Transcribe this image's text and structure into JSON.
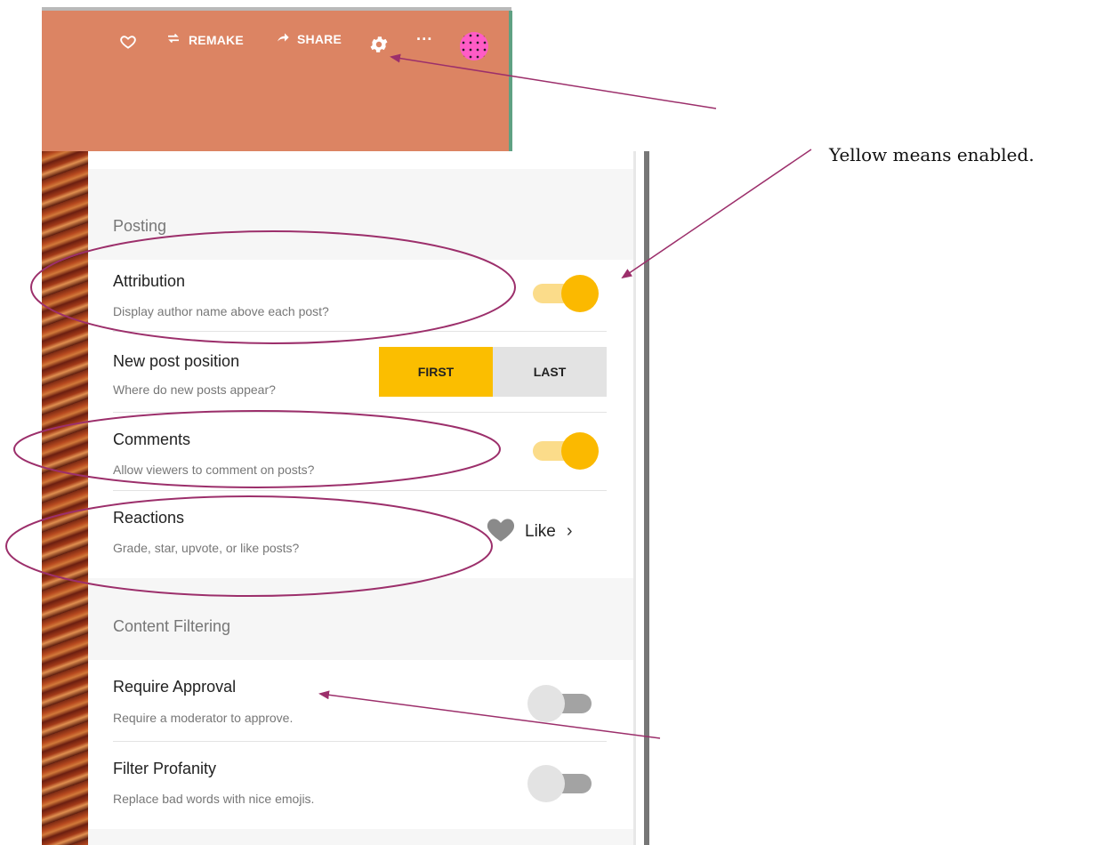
{
  "toolbar": {
    "remake_label": "REMAKE",
    "share_label": "SHARE",
    "more_label": "···",
    "icons": [
      "heart-icon",
      "remake-icon",
      "share-icon",
      "gear-icon",
      "more-icon",
      "avatar"
    ],
    "background_color": "#dc8463"
  },
  "settings": {
    "posting_section": "Posting",
    "attribution": {
      "title": "Attribution",
      "description": "Display author name above each post?",
      "enabled": true
    },
    "new_post_position": {
      "title": "New post position",
      "description": "Where do new posts appear?",
      "options": [
        "FIRST",
        "LAST"
      ],
      "selected": "FIRST"
    },
    "comments": {
      "title": "Comments",
      "description": "Allow viewers to comment on posts?",
      "enabled": true
    },
    "reactions": {
      "title": "Reactions",
      "description": "Grade, star, upvote, or like posts?",
      "value": "Like"
    },
    "content_filtering_section": "Content Filtering",
    "require_approval": {
      "title": "Require Approval",
      "description": "Require a moderator to approve.",
      "enabled": false
    },
    "filter_profanity": {
      "title": "Filter Profanity",
      "description": "Replace bad words with nice emojis.",
      "enabled": false
    }
  },
  "annotation": {
    "note_text": "Yellow means enabled.",
    "color": "#9c2f6b"
  },
  "colors": {
    "toggle_on_knob": "#fbb900",
    "toggle_on_track": "#fbdc8a",
    "toggle_off_knob": "#e3e3e3",
    "toggle_off_track": "#a3a3a3",
    "segment_selected": "#fbbe00"
  }
}
